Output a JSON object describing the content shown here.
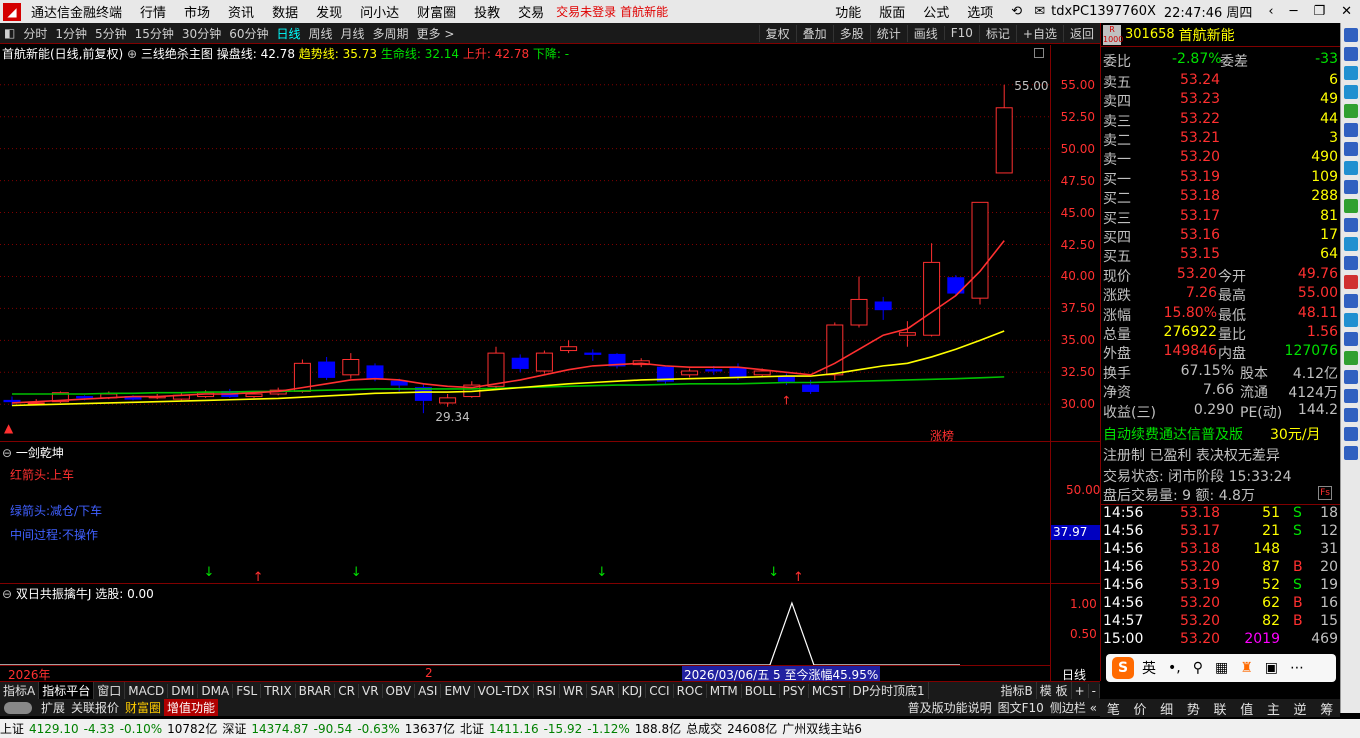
{
  "menubar": {
    "app_title": "通达信金融终端",
    "items": [
      "行情",
      "市场",
      "资讯",
      "数据",
      "发现",
      "问小达",
      "财富圈",
      "投教",
      "交易"
    ],
    "login_status": "交易未登录",
    "stock_tag": "首航新能",
    "right_items": [
      "功能",
      "版面",
      "公式",
      "选项"
    ],
    "host": "tdxPC1397760X",
    "time": "22:47:46 周四"
  },
  "toolbar": {
    "periods": [
      "分时",
      "1分钟",
      "5分钟",
      "15分钟",
      "30分钟",
      "60分钟",
      "日线",
      "周线",
      "月线",
      "多周期",
      "更多 >"
    ],
    "active_period": "日线",
    "right_buttons": [
      "复权",
      "叠加",
      "多股",
      "统计",
      "画线",
      "F10",
      "标记",
      "+自选",
      "返回"
    ]
  },
  "chart_title": {
    "name": "首航新能(日线,前复权)",
    "formula": "三线绝杀主图",
    "l1_label": "操盘线: ",
    "l1_val": "42.78",
    "l2_label": "趋势线: ",
    "l2_val": "35.73",
    "l3_label": "生命线: ",
    "l3_val": "32.14",
    "l4_label": "上升: ",
    "l4_val": "42.78",
    "l5_label": "下降: ",
    "l5_val": "-"
  },
  "colors": {
    "up": "#ff3030",
    "down": "#0000ff",
    "ma1": "#ff3030",
    "ma2": "#ffff00",
    "ma3": "#00c000",
    "grid": "#800000"
  },
  "chart_data": {
    "type": "candlestick",
    "ylim": [
      29,
      56
    ],
    "yticks": [
      "55.00",
      "52.50",
      "50.00",
      "47.50",
      "45.00",
      "42.50",
      "40.00",
      "37.50",
      "35.00",
      "32.50",
      "30.00"
    ],
    "high_label": "55.00",
    "low_label": "29.34",
    "tag_text": "涨榜",
    "candles": [
      [
        30.3,
        30.2,
        30.6,
        29.9
      ],
      [
        30.1,
        30.1,
        30.4,
        30.0
      ],
      [
        30.2,
        30.9,
        31.0,
        30.1
      ],
      [
        30.6,
        30.5,
        30.7,
        30.3
      ],
      [
        30.5,
        30.8,
        31.0,
        30.4
      ],
      [
        30.6,
        30.4,
        30.7,
        30.3
      ],
      [
        30.5,
        30.6,
        30.8,
        30.4
      ],
      [
        30.4,
        30.7,
        30.9,
        30.3
      ],
      [
        30.6,
        30.9,
        31.1,
        30.5
      ],
      [
        31.0,
        30.6,
        31.2,
        30.5
      ],
      [
        30.6,
        30.8,
        31.0,
        30.5
      ],
      [
        30.8,
        31.1,
        31.3,
        30.7
      ],
      [
        31.0,
        33.2,
        33.5,
        30.9
      ],
      [
        33.3,
        32.1,
        33.7,
        31.9
      ],
      [
        32.3,
        33.5,
        34.0,
        32.0
      ],
      [
        33.0,
        32.0,
        33.2,
        31.8
      ],
      [
        31.8,
        31.5,
        32.0,
        31.0
      ],
      [
        31.3,
        30.3,
        31.6,
        29.3
      ],
      [
        30.1,
        30.5,
        30.8,
        29.8
      ],
      [
        30.6,
        31.5,
        31.8,
        30.5
      ],
      [
        31.4,
        34.0,
        34.5,
        31.3
      ],
      [
        33.6,
        32.8,
        33.9,
        32.5
      ],
      [
        32.6,
        34.0,
        34.2,
        32.4
      ],
      [
        34.2,
        34.5,
        35.0,
        34.0
      ],
      [
        34.0,
        33.9,
        34.3,
        33.4
      ],
      [
        33.9,
        33.0,
        34.0,
        32.8
      ],
      [
        33.1,
        33.4,
        33.6,
        32.9
      ],
      [
        32.9,
        31.8,
        33.0,
        31.5
      ],
      [
        32.3,
        32.6,
        32.8,
        32.1
      ],
      [
        32.7,
        32.6,
        33.0,
        32.3
      ],
      [
        32.8,
        32.2,
        33.2,
        31.9
      ],
      [
        32.3,
        32.6,
        32.8,
        32.1
      ],
      [
        32.2,
        31.8,
        32.4,
        31.5
      ],
      [
        31.5,
        31.0,
        31.9,
        30.8
      ],
      [
        32.3,
        36.2,
        36.4,
        31.9
      ],
      [
        36.2,
        38.2,
        40.0,
        36.0
      ],
      [
        38.0,
        37.4,
        38.4,
        36.6
      ],
      [
        35.4,
        35.6,
        36.5,
        34.5
      ],
      [
        35.4,
        41.1,
        42.6,
        35.3
      ],
      [
        39.9,
        38.7,
        40.1,
        38.5
      ],
      [
        38.3,
        45.8,
        45.8,
        37.8
      ],
      [
        48.1,
        53.2,
        55.0,
        48.1
      ]
    ],
    "ma1": [
      30.1,
      30.2,
      30.3,
      30.4,
      30.5,
      30.6,
      30.6,
      30.7,
      30.8,
      30.8,
      30.9,
      31.0,
      31.3,
      31.6,
      31.9,
      32.0,
      31.9,
      31.6,
      31.4,
      31.3,
      31.6,
      31.9,
      32.3,
      32.7,
      33.0,
      33.1,
      33.2,
      33.0,
      32.9,
      32.9,
      32.9,
      32.7,
      32.5,
      32.3,
      33.2,
      34.3,
      35.4,
      35.9,
      37.2,
      38.5,
      40.4,
      42.8
    ],
    "ma2": [
      29.9,
      29.95,
      30.0,
      30.05,
      30.1,
      30.15,
      30.2,
      30.25,
      30.3,
      30.35,
      30.4,
      30.45,
      30.55,
      30.65,
      30.75,
      30.85,
      30.9,
      30.95,
      30.95,
      31.0,
      31.15,
      31.3,
      31.45,
      31.6,
      31.7,
      31.8,
      31.9,
      31.95,
      32.0,
      32.05,
      32.1,
      32.15,
      32.2,
      32.2,
      32.4,
      32.7,
      33.0,
      33.2,
      33.7,
      34.3,
      35.0,
      35.73
    ],
    "ma3": [
      30.8,
      30.8,
      30.8,
      30.8,
      30.85,
      30.85,
      30.9,
      30.9,
      30.95,
      30.95,
      31.0,
      31.0,
      31.05,
      31.1,
      31.15,
      31.2,
      31.2,
      31.2,
      31.2,
      31.2,
      31.25,
      31.3,
      31.35,
      31.4,
      31.45,
      31.5,
      31.5,
      31.55,
      31.6,
      31.6,
      31.6,
      31.65,
      31.7,
      31.7,
      31.75,
      31.8,
      31.85,
      31.9,
      31.95,
      32.0,
      32.07,
      32.14
    ],
    "sub1_arrows": [
      [
        8,
        "down"
      ],
      [
        10,
        "up"
      ],
      [
        14,
        "down"
      ],
      [
        24,
        "down"
      ],
      [
        31,
        "down"
      ],
      [
        32,
        "up"
      ]
    ],
    "sub2_peak": 32
  },
  "sub1": {
    "title": "一剑乾坤",
    "l1": "红箭头:上车",
    "l2": "绿箭头:减仓/下车",
    "l3": "中间过程:不操作",
    "axis_label": "50.00",
    "current_value": "37.97"
  },
  "sub2": {
    "title": "双日共振擒牛J 选股: 0.00",
    "axis_labels": [
      "1.00",
      "0.50"
    ]
  },
  "date_axis": {
    "year": "2026年",
    "month": "2",
    "info": "2026/03/06/五 5 至今涨幅45.95%",
    "period": "日线"
  },
  "quote": {
    "code": "301658",
    "name": "首航新能",
    "weibi_label": "委比",
    "weibi": "-2.87%",
    "weicha_label": "委差",
    "weicha": "-33",
    "asks": [
      [
        "卖五",
        "53.24",
        "6"
      ],
      [
        "卖四",
        "53.23",
        "49"
      ],
      [
        "卖三",
        "53.22",
        "44"
      ],
      [
        "卖二",
        "53.21",
        "3"
      ],
      [
        "卖一",
        "53.20",
        "490"
      ]
    ],
    "bids": [
      [
        "买一",
        "53.19",
        "109"
      ],
      [
        "买二",
        "53.18",
        "288"
      ],
      [
        "买三",
        "53.17",
        "81"
      ],
      [
        "买四",
        "53.16",
        "17"
      ],
      [
        "买五",
        "53.15",
        "64"
      ]
    ],
    "stats": [
      [
        "现价",
        "53.20",
        "今开",
        "49.76"
      ],
      [
        "涨跌",
        "7.26",
        "最高",
        "55.00"
      ],
      [
        "涨幅",
        "15.80%",
        "最低",
        "48.11"
      ],
      [
        "总量",
        "276922",
        "量比",
        "1.56"
      ],
      [
        "外盘",
        "149846",
        "内盘",
        "127076"
      ]
    ],
    "stats2": [
      [
        "换手",
        "67.15%",
        "股本",
        "4.12亿"
      ],
      [
        "净资",
        "7.66",
        "流通",
        "4124万"
      ],
      [
        "收益(三)",
        "0.290",
        "PE(动)",
        "144.2"
      ]
    ],
    "ad1": "自动续费通达信普及版",
    "ad_price": "30元/月",
    "ad2": "注册制 已盈利 表决权无差异",
    "trade_state": "交易状态: 闭市阶段 15:33:24",
    "after_hours": "盘后交易量: 9  额: 4.8万"
  },
  "ticks": [
    [
      "14:56",
      "53.18",
      "51",
      "S",
      "18"
    ],
    [
      "14:56",
      "53.17",
      "21",
      "S",
      "12"
    ],
    [
      "14:56",
      "53.18",
      "148",
      "",
      "31"
    ],
    [
      "14:56",
      "53.20",
      "87",
      "B",
      "20"
    ],
    [
      "14:56",
      "53.19",
      "52",
      "S",
      "19"
    ],
    [
      "14:56",
      "53.20",
      "62",
      "B",
      "16"
    ],
    [
      "14:57",
      "53.20",
      "82",
      "B",
      "15"
    ],
    [
      "15:00",
      "53.20",
      "2019",
      "",
      "469"
    ]
  ],
  "bottom_tabs": [
    "指标A",
    "指标平台",
    "窗口",
    "MACD",
    "DMI",
    "DMA",
    "FSL",
    "TRIX",
    "BRAR",
    "CR",
    "VR",
    "OBV",
    "ASI",
    "EMV",
    "VOL-TDX",
    "RSI",
    "WR",
    "SAR",
    "KDJ",
    "CCI",
    "ROC",
    "MTM",
    "BOLL",
    "PSY",
    "MCST",
    "DP分时顶底1"
  ],
  "bottom_tabs_right": [
    "指标B",
    "模 板",
    "+",
    "-"
  ],
  "bottom2": [
    "扩展",
    "关联报价",
    "财富圈",
    "增值功能"
  ],
  "bottom2_right": [
    "普及版功能说明",
    "图文F10",
    "侧边栏 «"
  ],
  "right_bottom": [
    "笔",
    "价",
    "细",
    "势",
    "联",
    "值",
    "主",
    "逆",
    "筹"
  ],
  "ime": [
    "英",
    "•,",
    "🎤"
  ],
  "status": {
    "sh_label": "上证",
    "sh": "4129.10",
    "sh_chg": "-4.33",
    "sh_pct": "-0.10%",
    "sh_amt": "10782亿",
    "sz_label": "深证",
    "sz": "14374.87",
    "sz_chg": "-90.54",
    "sz_pct": "-0.63%",
    "sz_amt": "13637亿",
    "bz_label": "北证",
    "bz": "1411.16",
    "bz_chg": "-15.92",
    "bz_pct": "-1.12%",
    "bz_amt": "188.8亿",
    "total_label": "总成交",
    "total": "24608亿",
    "server": "广州双线主站6"
  }
}
